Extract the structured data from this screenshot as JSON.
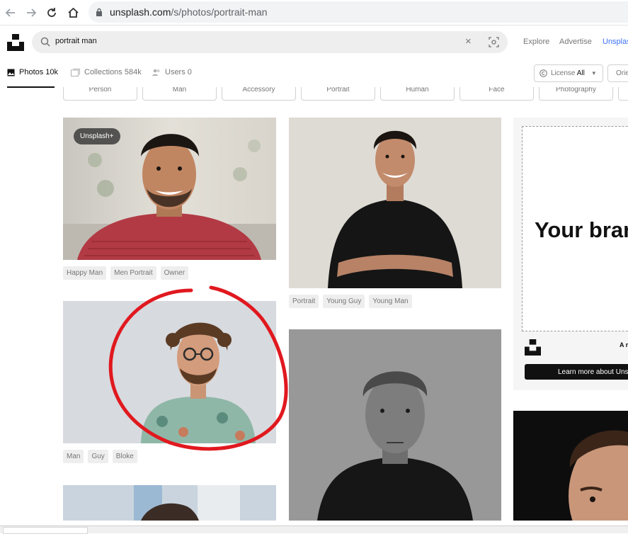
{
  "browser": {
    "url_domain": "unsplash.com",
    "url_path": "/s/photos/portrait-man"
  },
  "header": {
    "search_value": "portrait man",
    "nav": [
      "Explore",
      "Advertise",
      "Unsplash+"
    ]
  },
  "filters": {
    "tabs": [
      {
        "label": "Photos 10k",
        "active": true
      },
      {
        "label": "Collections 584k",
        "active": false
      },
      {
        "label": "Users 0",
        "active": false
      }
    ],
    "license_prefix": "License",
    "license_value": "All",
    "orientation_label": "Orientation"
  },
  "related": [
    "Person",
    "Man",
    "Accessory",
    "Portrait",
    "Human",
    "Face",
    "Photography"
  ],
  "photos": [
    {
      "badge": "Unsplash+",
      "tags": [
        "Happy Man",
        "Men Portrait",
        "Owner"
      ]
    },
    {
      "tags": [
        "Portrait",
        "Young Guy",
        "Young Man"
      ]
    },
    {
      "tags": [
        "Man",
        "Guy",
        "Bloke"
      ]
    }
  ],
  "ad": {
    "headline": "Your brand",
    "small_text": "A message",
    "cta": "Learn more about Unsplash+"
  },
  "colors": {
    "annotation": "#e0191f",
    "accent": "#3b6ff5"
  }
}
